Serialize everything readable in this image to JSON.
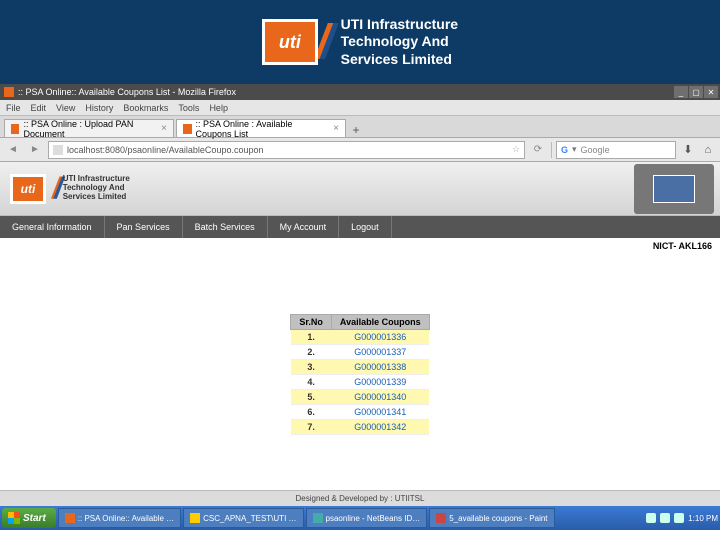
{
  "banner": {
    "logo_text": "uti",
    "title_line1": "UTI Infrastructure",
    "title_line2": "Technology And",
    "title_line3": "Services Limited"
  },
  "firefox": {
    "window_title": ":: PSA Online:: Available Coupons List - Mozilla Firefox",
    "menu": [
      "File",
      "Edit",
      "View",
      "History",
      "Bookmarks",
      "Tools",
      "Help"
    ],
    "tabs": [
      {
        "label": ":: PSA Online : Upload PAN Document",
        "active": false
      },
      {
        "label": ":: PSA Online : Available Coupons List",
        "active": true
      }
    ],
    "url": "localhost:8080/psaonline/AvailableCoupo.coupon",
    "search_placeholder": "Google"
  },
  "page": {
    "small_logo_text": "UTI Infrastructure\nTechnology And\nServices Limited",
    "nav": [
      "General Information",
      "Pan Services",
      "Batch Services",
      "My Account",
      "Logout"
    ],
    "user_label": "NICT- AKL166",
    "table": {
      "headers": [
        "Sr.No",
        "Available Coupons"
      ],
      "rows": [
        {
          "sr": "1.",
          "coupon": "G000001336",
          "hl": true
        },
        {
          "sr": "2.",
          "coupon": "G000001337",
          "hl": false
        },
        {
          "sr": "3.",
          "coupon": "G000001338",
          "hl": true
        },
        {
          "sr": "4.",
          "coupon": "G000001339",
          "hl": false
        },
        {
          "sr": "5.",
          "coupon": "G000001340",
          "hl": true
        },
        {
          "sr": "6.",
          "coupon": "G000001341",
          "hl": false
        },
        {
          "sr": "7.",
          "coupon": "G000001342",
          "hl": true
        }
      ]
    },
    "footer": "Designed & Developed by : UTIITSL"
  },
  "taskbar": {
    "start": "Start",
    "items": [
      ":: PSA Online:: Available …",
      "CSC_APNA_TEST\\UTI …",
      "psaonline - NetBeans ID…",
      "5_available coupons - Paint"
    ],
    "time": "1:10 PM"
  }
}
